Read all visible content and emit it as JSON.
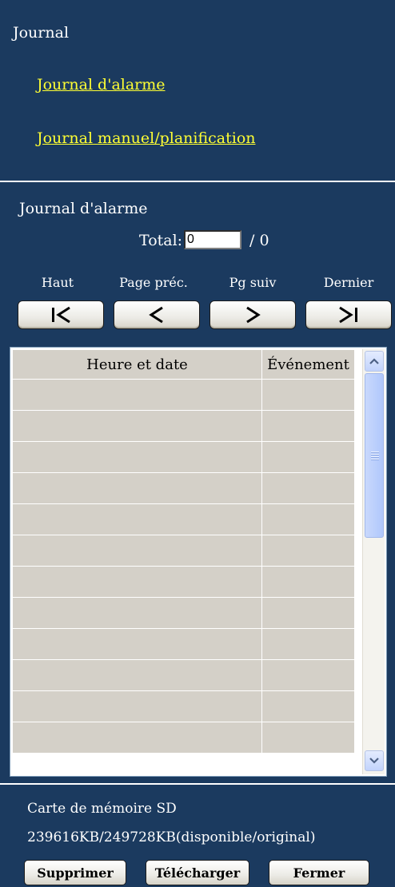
{
  "journal": {
    "heading": "Journal",
    "links": [
      "Journal d'alarme",
      "Journal manuel/planification"
    ]
  },
  "log": {
    "heading": "Journal d'alarme",
    "total_label": "Total:",
    "total_value": "0",
    "total_suffix": "/ 0",
    "nav": {
      "first_label": "Haut",
      "prev_label": "Page préc.",
      "next_label": "Pg suiv",
      "last_label": "Dernier"
    },
    "table": {
      "columns": [
        "Heure et date",
        "Événement"
      ],
      "rows": [
        [
          "",
          ""
        ],
        [
          "",
          ""
        ],
        [
          "",
          ""
        ],
        [
          "",
          ""
        ],
        [
          "",
          ""
        ],
        [
          "",
          ""
        ],
        [
          "",
          ""
        ],
        [
          "",
          ""
        ],
        [
          "",
          ""
        ],
        [
          "",
          ""
        ],
        [
          "",
          ""
        ],
        [
          "",
          ""
        ]
      ]
    }
  },
  "sd": {
    "title": "Carte de mémoire SD",
    "capacity": "239616KB/249728KB(disponible/original)"
  },
  "actions": {
    "delete_label": "Supprimer",
    "download_label": "Télécharger",
    "close_label": "Fermer"
  },
  "colors": {
    "panel_bg": "#1b3a5f",
    "link": "#ffff33",
    "table_cell": "#d4d0c8",
    "scrollbar_accent": "#c2d3fc"
  }
}
